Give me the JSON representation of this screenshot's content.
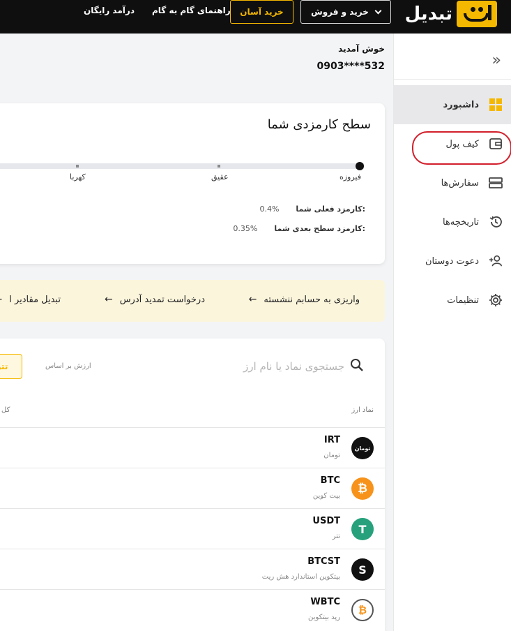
{
  "header": {
    "logo_text": "تبدیل",
    "buy_sell_label": "خرید و فروش",
    "easy_buy_label": "خرید آسان",
    "guide_label": "راهنمای گام به گام",
    "income_label": "درآمد رایگان"
  },
  "sidebar": {
    "items": [
      {
        "label": "داشبورد",
        "icon": "dashboard-grid-icon"
      },
      {
        "label": "کیف پول",
        "icon": "wallet-icon"
      },
      {
        "label": "سفارش‌ها",
        "icon": "orders-icon"
      },
      {
        "label": "تاریخچه‌ها",
        "icon": "history-icon"
      },
      {
        "label": "دعوت دوستان",
        "icon": "add-user-icon"
      },
      {
        "label": "تنظیمات",
        "icon": "gear-icon"
      }
    ]
  },
  "welcome": {
    "title": "خوش آمدید",
    "phone": "0903****532"
  },
  "fee_card": {
    "title": "سطح کارمزدی شما",
    "levels": [
      "فیروزه",
      "عقیق",
      "کهربا"
    ],
    "current_fee_label": "کارمزد فعلی شما:",
    "current_fee_value": "0.4%",
    "next_fee_label": "کارمزد سطح بعدی شما:",
    "next_fee_value": "0.35%"
  },
  "quick_links": [
    "واریزی به حسابم ننشسته",
    "درخواست تمدید آدرس",
    "تبدیل مقادیر ا"
  ],
  "assets": {
    "search_placeholder": "جستجوی نماد یا نام ارز",
    "base_label": "ارزش بر اساس",
    "currency_chip": "تتر",
    "col_symbol": "نماد ارز",
    "col_left": "کل",
    "rows": [
      {
        "symbol": "IRT",
        "name": "تومان",
        "icon_text": "تومان"
      },
      {
        "symbol": "BTC",
        "name": "بیت کوین",
        "icon_text": "₿"
      },
      {
        "symbol": "USDT",
        "name": "تتر",
        "icon_text": "T"
      },
      {
        "symbol": "BTCST",
        "name": "بیتکوین استاندارد هش ریت",
        "icon_text": "S"
      },
      {
        "symbol": "WBTC",
        "name": "رپد بیتکوین",
        "icon_text": "₿"
      }
    ]
  },
  "colors": {
    "accent": "#f5b800",
    "topbar": "#0f0f10",
    "annotation": "#d21f2b"
  }
}
